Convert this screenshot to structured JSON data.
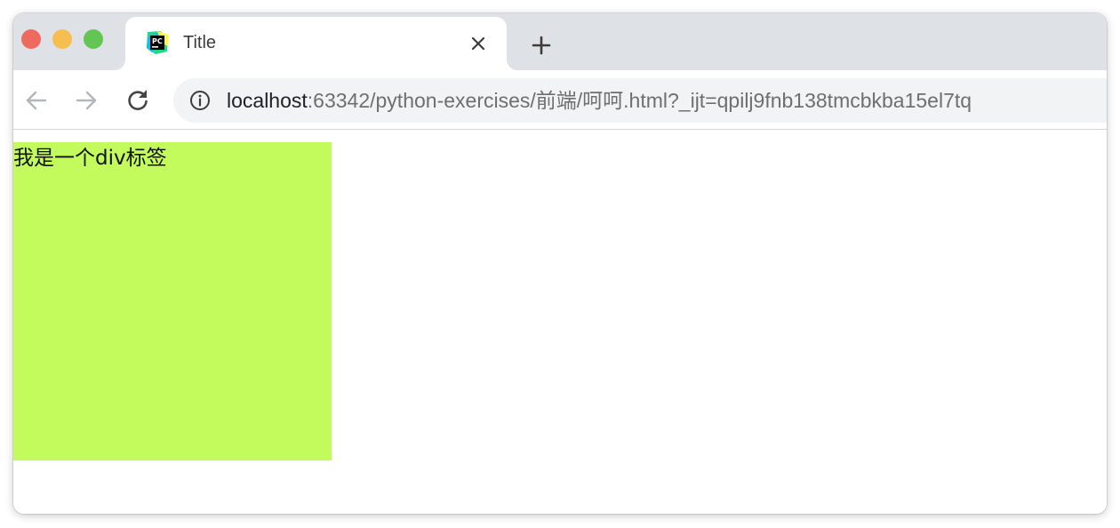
{
  "tab": {
    "title": "Title",
    "favicon_icon": "pycharm-icon"
  },
  "toolbar": {
    "back_icon": "arrow-left-icon",
    "forward_icon": "arrow-right-icon",
    "reload_icon": "reload-icon",
    "url_host": "localhost",
    "url_rest": ":63342/python-exercises/前端/呵呵.html?_ijt=qpilj9fnb138tmcbkba15el7tq"
  },
  "page": {
    "div_text": "我是一个div标签",
    "div_color": "#c3fb5c"
  },
  "colors": {
    "tabstrip": "#dee1e6",
    "traffic_close": "#ee6a5f",
    "traffic_min": "#f5be4f",
    "traffic_max": "#62c554"
  }
}
